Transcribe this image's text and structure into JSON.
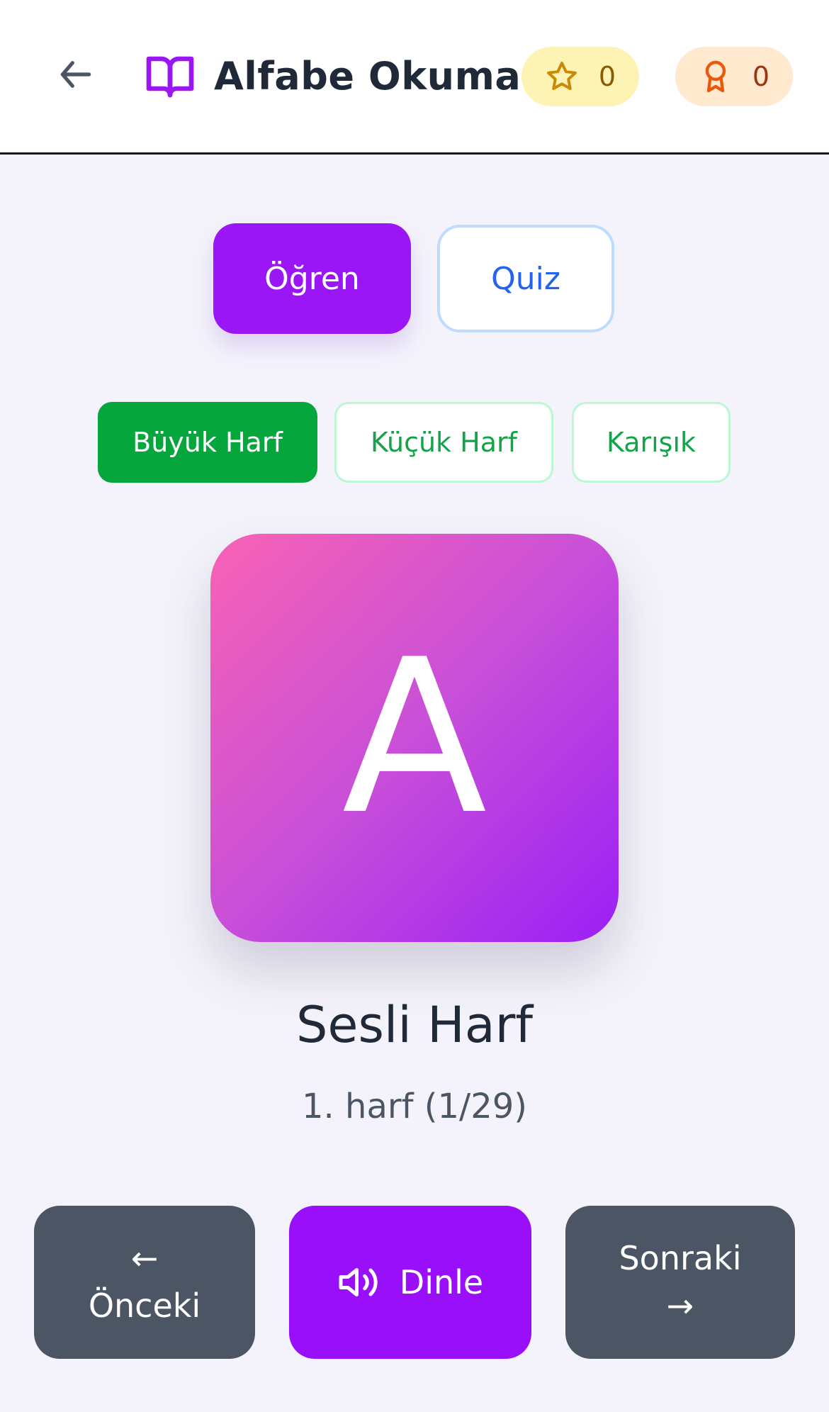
{
  "header": {
    "title": "Alfabe Okuma",
    "stars": "0",
    "awards": "0"
  },
  "modes": {
    "learn": "Öğren",
    "quiz": "Quiz"
  },
  "cases": {
    "upper": "Büyük Harf",
    "lower": "Küçük Harf",
    "mixed": "Karışık"
  },
  "card": {
    "letter": "A",
    "type": "Sesli Harf",
    "position": "1. harf (1/29)"
  },
  "nav": {
    "prev_arrow": "←",
    "prev_label": "Önceki",
    "listen_label": "Dinle",
    "next_label": "Sonraki",
    "next_arrow": "→"
  },
  "colors": {
    "accent": "#9a16f5",
    "green": "#05a63c",
    "quiz_blue": "#2563eb",
    "nav_gray": "#4b5563"
  },
  "icons": [
    "arrow-left-icon",
    "book-open-icon",
    "star-icon",
    "award-icon",
    "volume-icon"
  ]
}
